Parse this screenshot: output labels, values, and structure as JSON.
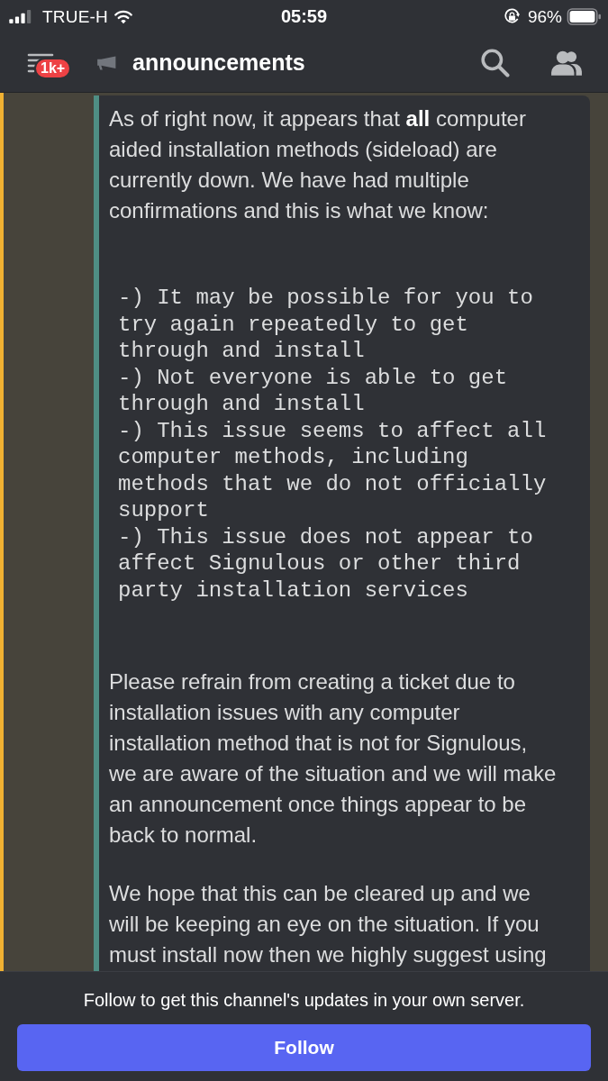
{
  "status_bar": {
    "carrier": "TRUE-H",
    "time": "05:59",
    "battery": "96%"
  },
  "header": {
    "unread_badge": "1k+",
    "channel_name": "announcements"
  },
  "message": {
    "highlighted": true,
    "embed": {
      "blocks": [
        {
          "kind": "paragraph",
          "text": "As of right now, it appears that **all** computer aided installation methods (sideload) are currently down. We have had multiple confirmations and this is what we know:"
        },
        {
          "kind": "code",
          "lines": [
            "-) It may be possible for you to try again repeatedly to get through and install",
            "-) Not everyone is able to get through and install",
            "-) This issue seems to affect all computer methods, including methods that we do not officially support",
            "-) This issue does not appear to affect Signulous or other third party installation services"
          ]
        },
        {
          "kind": "paragraph",
          "text": "Please refrain from creating a ticket due to installation issues with any computer installation method that is not for Signulous, we are aware of the situation and we will make an announcement once things appear to be back to normal."
        },
        {
          "kind": "paragraph",
          "text": "We hope that this can be cleared up and we will be keeping an eye on the situation. If you must install now then we highly suggest using"
        }
      ]
    }
  },
  "follow_panel": {
    "prompt": "Follow to get this channel's updates in your own server.",
    "button": "Follow"
  }
}
